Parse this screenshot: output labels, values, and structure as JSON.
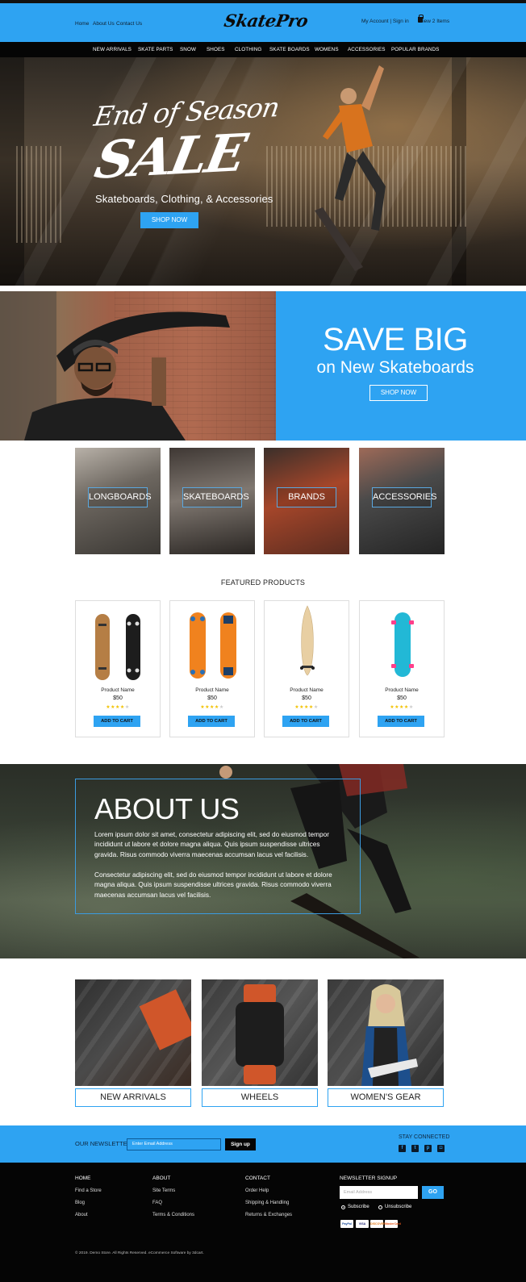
{
  "header": {
    "links": [
      "Home",
      "About Us",
      "Contact Us"
    ],
    "logo": "SkatePro",
    "account": "My Account | Sign in",
    "cart": "View 2 Items"
  },
  "nav": [
    "NEW ARRIVALS",
    "SKATE PARTS",
    "SNOW",
    "SHOES",
    "CLOTHING",
    "SKATE BOARDS",
    "WOMENS",
    "ACCESSORIES",
    "POPULAR BRANDS"
  ],
  "hero": {
    "line1": "End of Season",
    "line2": "SALE",
    "subtitle": "Skateboards, Clothing, & Accessories",
    "button": "SHOP NOW"
  },
  "promo": {
    "title": "SAVE BIG",
    "subtitle": "on New Skateboards",
    "button": "SHOP NOW"
  },
  "categories": [
    "LONGBOARDS",
    "SKATEBOARDS",
    "BRANDS",
    "ACCESSORIES"
  ],
  "featured": {
    "title": "FEATURED PRODUCTS",
    "products": [
      {
        "name": "Product Name",
        "price": "$50",
        "rating": 4,
        "button": "ADD TO CART"
      },
      {
        "name": "Product Name",
        "price": "$50",
        "rating": 4,
        "button": "ADD TO CART"
      },
      {
        "name": "Product Name",
        "price": "$50",
        "rating": 4,
        "button": "ADD TO CART"
      },
      {
        "name": "Product Name",
        "price": "$50",
        "rating": 4,
        "button": "ADD TO CART"
      }
    ]
  },
  "about": {
    "title": "ABOUT US",
    "p1": "Lorem ipsum dolor sit amet, consectetur adipiscing elit, sed do eiusmod tempor incididunt ut labore et dolore magna aliqua. Quis ipsum suspendisse ultrices gravida. Risus commodo viverra maecenas accumsan lacus vel facilisis.",
    "p2": "Consectetur adipiscing elit, sed do eiusmod tempor incididunt ut labore et dolore magna aliqua. Quis ipsum suspendisse ultrices gravida. Risus commodo viverra maecenas accumsan lacus vel facilisis."
  },
  "bottom_categories": [
    "NEW ARRIVALS",
    "WHEELS",
    "WOMEN'S GEAR"
  ],
  "newsletter_bar": {
    "label": "OUR NEWSLETTER",
    "placeholder": "Enter Email Address",
    "button": "Sign up",
    "stay_connected": "STAY CONNECTED",
    "social_icons": [
      "facebook-icon",
      "twitter-icon",
      "pinterest-icon",
      "instagram-icon"
    ]
  },
  "footer": {
    "col1": {
      "heading": "HOME",
      "links": [
        "Find a Store",
        "Blog",
        "About"
      ]
    },
    "col2": {
      "heading": "ABOUT",
      "links": [
        "Site Terms",
        "FAQ",
        "Terms & Conditions"
      ]
    },
    "col3": {
      "heading": "CONTACT",
      "links": [
        "Order Help",
        "Shipping & Handling",
        "Returns & Exchanges"
      ]
    },
    "signup": {
      "heading": "NEWSLETTER SIGNUP",
      "placeholder": "Email Address",
      "button": "GO",
      "options": [
        "Subscribe",
        "Unsubscribe"
      ],
      "selected": "Subscribe"
    },
    "payments": [
      "PayPal",
      "VISA",
      "DISCOVER",
      "MasterCard"
    ],
    "copyright": "© 2019. Demo Store. All Rights Reserved. eCommerce Software by 3dcart."
  },
  "colors": {
    "accent": "#2ea3f2",
    "dark": "#050505"
  }
}
